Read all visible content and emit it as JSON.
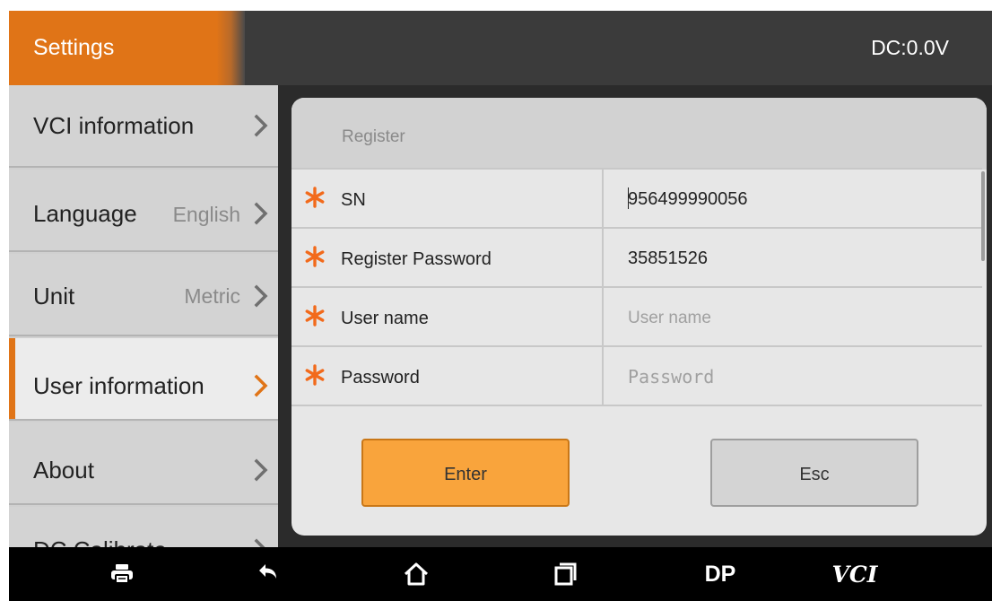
{
  "header": {
    "title": "Settings",
    "dc_readout": "DC:0.0V"
  },
  "sidebar": {
    "items": [
      {
        "label": "VCI information",
        "value": "",
        "active": false
      },
      {
        "label": "Language",
        "value": "English",
        "active": false
      },
      {
        "label": "Unit",
        "value": "Metric",
        "active": false
      },
      {
        "label": "User information",
        "value": "",
        "active": true
      },
      {
        "label": "About",
        "value": "",
        "active": false
      },
      {
        "label": "DC Calibrate",
        "value": "",
        "active": false
      }
    ]
  },
  "panel": {
    "title": "Register",
    "fields": [
      {
        "label": "SN",
        "value": "956499990056",
        "placeholder": "",
        "required": true
      },
      {
        "label": "Register Password",
        "value": "35851526",
        "placeholder": "",
        "required": true
      },
      {
        "label": "User name",
        "value": "",
        "placeholder": "User name",
        "required": true
      },
      {
        "label": "Password",
        "value": "",
        "placeholder": "Password",
        "required": true
      }
    ],
    "enter_label": "Enter",
    "esc_label": "Esc"
  },
  "navbar": {
    "items": [
      {
        "icon": "printer-icon"
      },
      {
        "icon": "back-icon"
      },
      {
        "icon": "home-icon"
      },
      {
        "icon": "recent-apps-icon"
      },
      {
        "label": "DP"
      },
      {
        "label": "VCI"
      }
    ]
  },
  "colors": {
    "accent": "#e07417",
    "required_star": "#f26a1b",
    "enter_button": "#f9a43c"
  }
}
